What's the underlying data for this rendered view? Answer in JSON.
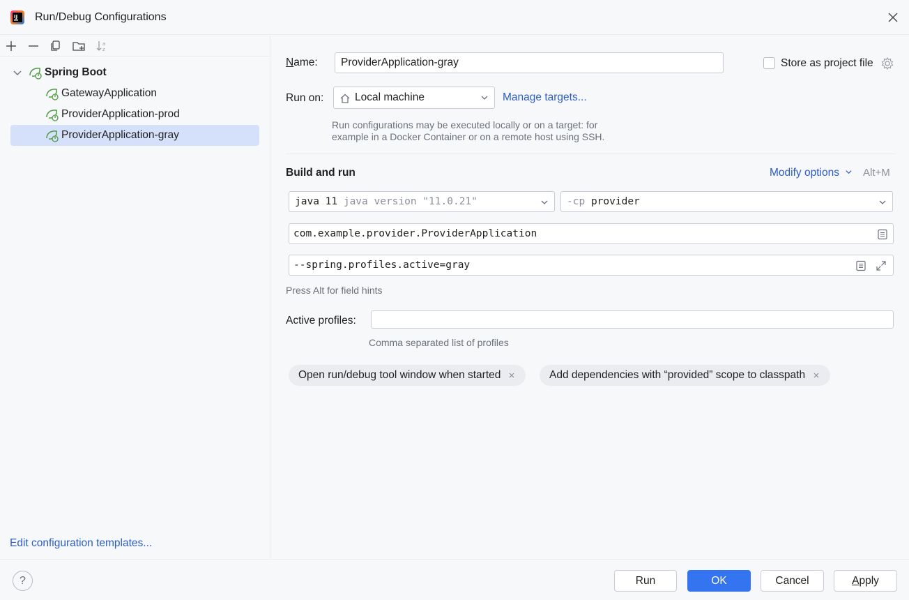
{
  "window": {
    "title": "Run/Debug Configurations"
  },
  "tree": {
    "group_label": "Spring Boot",
    "items": [
      {
        "label": "GatewayApplication"
      },
      {
        "label": "ProviderApplication-prod"
      },
      {
        "label": "ProviderApplication-gray"
      }
    ]
  },
  "left": {
    "edit_templates": "Edit configuration templates..."
  },
  "form": {
    "name_label": "Name:",
    "name_value": "ProviderApplication-gray",
    "store_label": "Store as project file",
    "runon_label": "Run on:",
    "runon_value": "Local machine",
    "manage_targets": "Manage targets...",
    "runon_hint_1": "Run configurations may be executed locally or on a target: for",
    "runon_hint_2": "example in a Docker Container or on a remote host using SSH.",
    "build_title": "Build and run",
    "modify_options": "Modify options",
    "modify_shortcut": "Alt+M",
    "jdk_name": "java 11",
    "jdk_version": "java version \"11.0.21\"",
    "cp_prefix": "-cp",
    "cp_value": "provider",
    "main_class": "com.example.provider.ProviderApplication",
    "program_args": "--spring.profiles.active=gray",
    "field_hints": "Press Alt for field hints",
    "profiles_label": "Active profiles:",
    "profiles_value": "",
    "profiles_hint": "Comma separated list of profiles"
  },
  "chips": [
    {
      "label": "Open run/debug tool window when started"
    },
    {
      "label": "Add dependencies with “provided” scope to classpath"
    }
  ],
  "buttons": {
    "run": "Run",
    "ok": "OK",
    "cancel": "Cancel",
    "apply": "Apply",
    "help": "?"
  },
  "colors": {
    "accent": "#3574f0",
    "link": "#2c5cc5",
    "selection": "#d5e1fb",
    "spring_green": "#4c9a3f"
  }
}
